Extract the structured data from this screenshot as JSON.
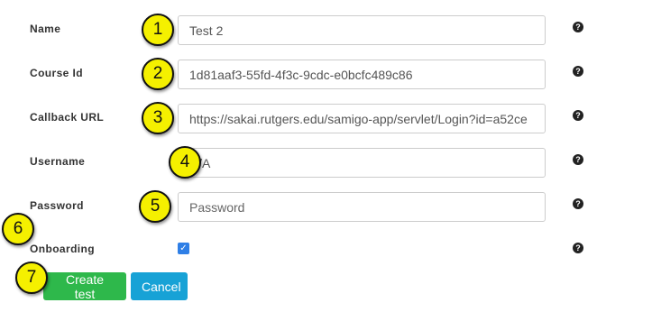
{
  "form": {
    "name": {
      "label": "Name",
      "value": "Test 2",
      "marker": "1"
    },
    "course_id": {
      "label": "Course Id",
      "value": "1d81aaf3-55fd-4f3c-9cdc-e0bcfc489c86",
      "marker": "2"
    },
    "callback_url": {
      "label": "Callback URL",
      "value": "https://sakai.rutgers.edu/samigo-app/servlet/Login?id=a52ce",
      "marker": "3"
    },
    "username": {
      "label": "Username",
      "value": "N/A",
      "marker": "4"
    },
    "password": {
      "label": "Password",
      "placeholder": "Password",
      "value": "",
      "marker": "5"
    },
    "onboarding": {
      "label": "Onboarding",
      "checked": true,
      "marker": "6"
    }
  },
  "help_icon": "?",
  "actions": {
    "create_label": "Create test",
    "cancel_label": "Cancel",
    "marker": "7"
  },
  "colors": {
    "marker_fill": "#f5f000",
    "create_button": "#2eb84b",
    "cancel_button": "#17a2d6",
    "checkbox": "#2f7fe6"
  }
}
